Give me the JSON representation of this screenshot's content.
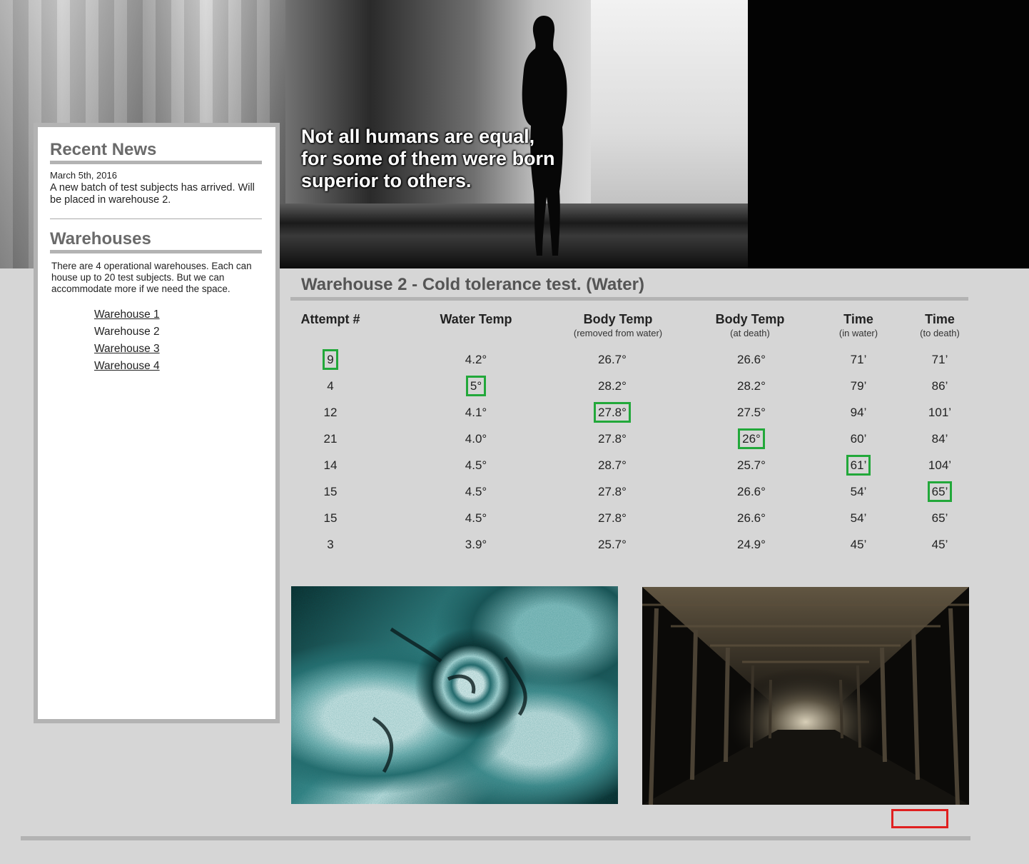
{
  "hero": {
    "quote_line1": "Not all humans are equal,",
    "quote_line2": "for some of them were born",
    "quote_line3": "superior to others."
  },
  "sidebar": {
    "news_title": "Recent News",
    "news_date": "March 5th, 2016",
    "news_body": "A new batch of test subjects has arrived. Will be placed in warehouse 2.",
    "warehouses_title": "Warehouses",
    "warehouses_desc": "There are 4 operational warehouses. Each can house up to 20 test subjects. But we can accommodate more if we need the space.",
    "links": [
      "Warehouse 1",
      "Warehouse 2",
      "Warehouse 3",
      "Warehouse 4"
    ]
  },
  "main": {
    "title": "Warehouse 2 - Cold tolerance test. (Water)",
    "columns": [
      {
        "label": "Attempt #",
        "sub": ""
      },
      {
        "label": "Water Temp",
        "sub": ""
      },
      {
        "label": "Body Temp",
        "sub": "(removed from water)"
      },
      {
        "label": "Body Temp",
        "sub": "(at death)"
      },
      {
        "label": "Time",
        "sub": "(in water)"
      },
      {
        "label": "Time",
        "sub": "(to death)"
      }
    ],
    "rows": [
      [
        "9",
        "4.2°",
        "26.7°",
        "26.6°",
        "71’",
        "71’"
      ],
      [
        "4",
        "5°",
        "28.2°",
        "28.2°",
        "79’",
        "86’"
      ],
      [
        "12",
        "4.1°",
        "27.8°",
        "27.5°",
        "94’",
        "101’"
      ],
      [
        "21",
        "4.0°",
        "27.8°",
        "26°",
        "60’",
        "84’"
      ],
      [
        "14",
        "4.5°",
        "28.7°",
        "25.7°",
        "61’",
        "104’"
      ],
      [
        "15",
        "4.5°",
        "27.8°",
        "26.6°",
        "54’",
        "65’"
      ],
      [
        "15",
        "4.5°",
        "27.8°",
        "26.6°",
        "54’",
        "65’"
      ],
      [
        "3",
        "3.9°",
        "25.7°",
        "24.9°",
        "45’",
        "45’"
      ]
    ]
  },
  "colors": {
    "highlight": "#22a83a",
    "marker": "#e02020",
    "panel_border": "#b3b3b3",
    "background": "#d6d6d6"
  }
}
